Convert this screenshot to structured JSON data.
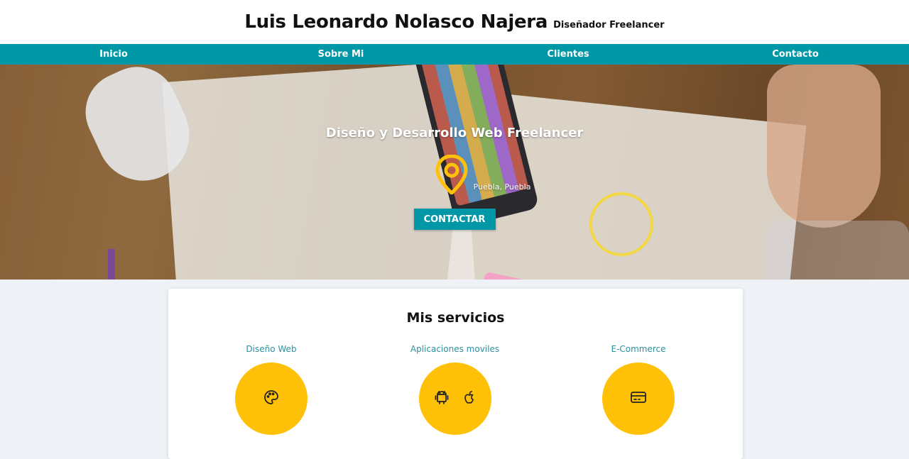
{
  "header": {
    "title": "Luis Leonardo Nolasco Najera",
    "subtitle": "Diseñador Freelancer"
  },
  "nav": {
    "items": [
      "Inicio",
      "Sobre Mi",
      "Clientes",
      "Contacto"
    ]
  },
  "hero": {
    "title": "Diseño y Desarrollo Web Freelancer",
    "location": "Puebla, Puebla",
    "location_icon": "map-pin-icon",
    "button": "CONTACTAR"
  },
  "services": {
    "title": "Mis servicios",
    "items": [
      {
        "name": "Diseño Web",
        "icons": [
          "palette-icon"
        ]
      },
      {
        "name": "Aplicaciones moviles",
        "icons": [
          "android-icon",
          "apple-icon"
        ]
      },
      {
        "name": "E-Commerce",
        "icons": [
          "credit-card-icon"
        ]
      }
    ]
  },
  "colors": {
    "primary": "#0097a7",
    "accent": "#ffc107",
    "service_text": "#2b8fa0",
    "background": "#eef2f6"
  }
}
